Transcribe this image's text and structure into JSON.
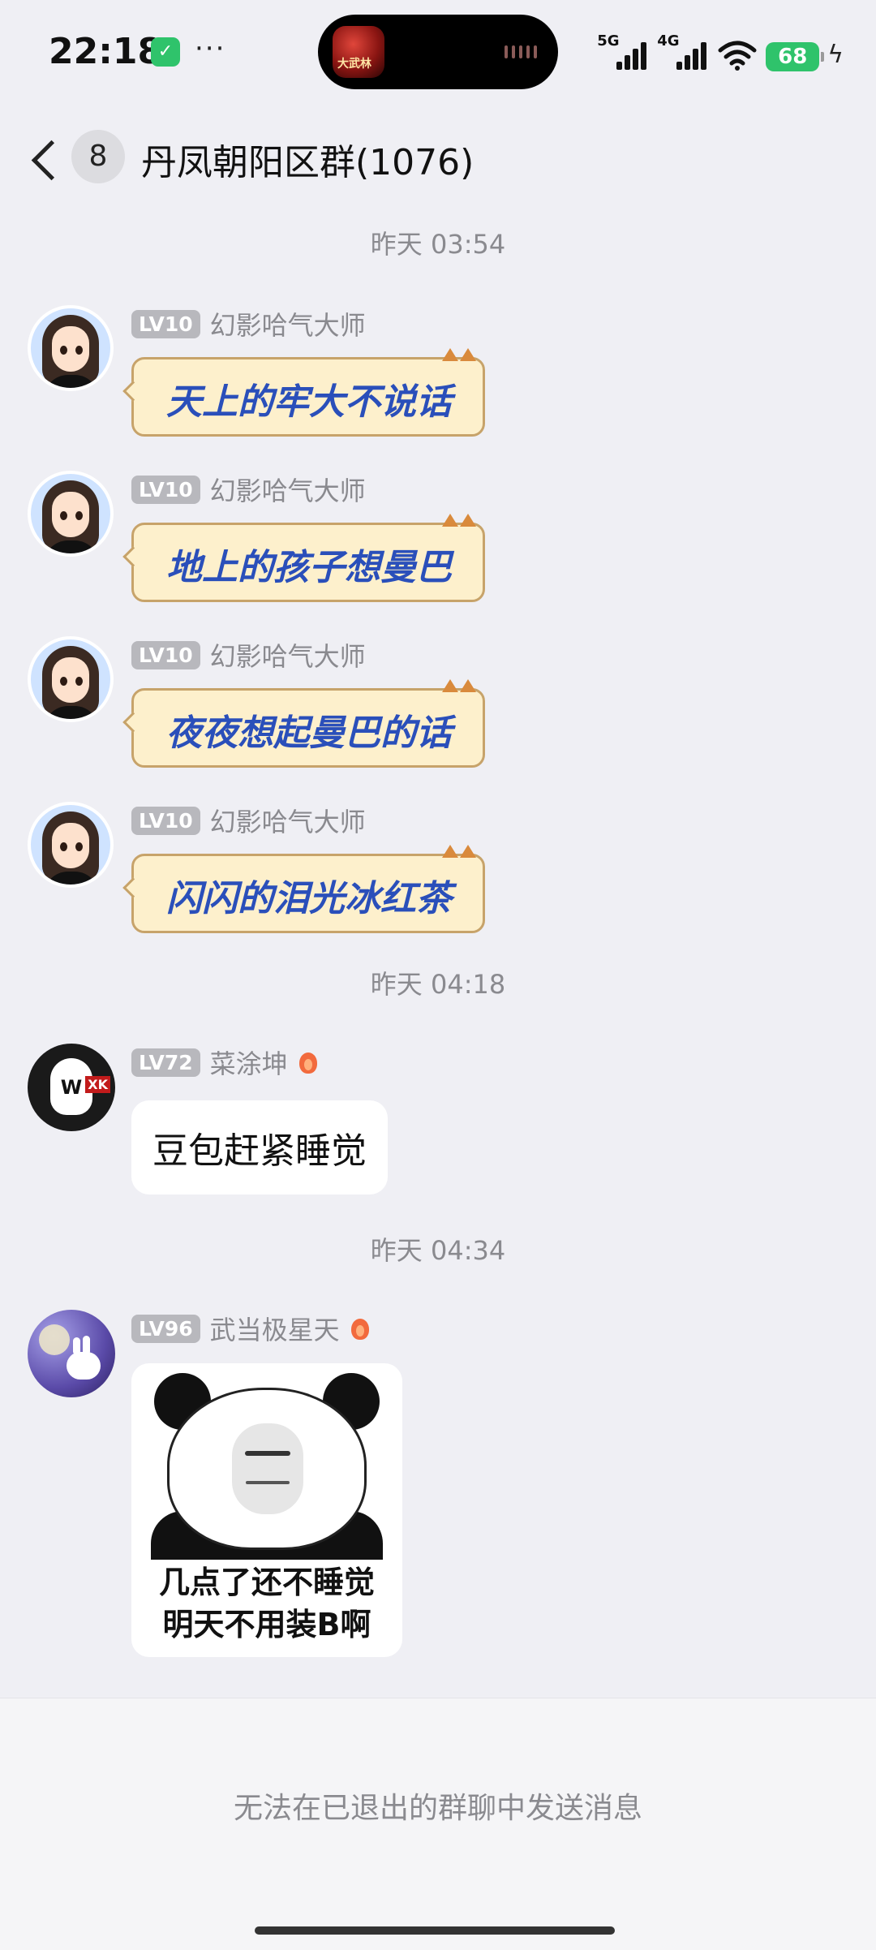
{
  "status_bar": {
    "time": "22:18",
    "shield_icon": "shield-check-icon",
    "dots": "···",
    "island_game_label": "大武林",
    "network_5g": "5G",
    "network_4g": "4G",
    "battery": "68",
    "charging_icon": "bolt-icon",
    "shield_color": "#2fc36b",
    "battery_color": "#2fc36b"
  },
  "header": {
    "unread_count": "8",
    "title": "丹凤朝阳区群(1076)",
    "back_icon": "chevron-left-icon"
  },
  "chat": {
    "time_separators": [
      "昨天 03:54",
      "昨天 04:18",
      "昨天 04:34"
    ],
    "messages": [
      {
        "level": "LV10",
        "nickname": "幻影哈气大师",
        "text": "天上的牢大不说话",
        "style": "cat-bubble"
      },
      {
        "level": "LV10",
        "nickname": "幻影哈气大师",
        "text": "地上的孩子想曼巴",
        "style": "cat-bubble"
      },
      {
        "level": "LV10",
        "nickname": "幻影哈气大师",
        "text": "夜夜想起曼巴的话",
        "style": "cat-bubble"
      },
      {
        "level": "LV10",
        "nickname": "幻影哈气大师",
        "text": "闪闪的泪光冰红茶",
        "style": "cat-bubble"
      },
      {
        "level": "LV72",
        "nickname": "菜涂坤",
        "text": "豆包赶紧睡觉",
        "style": "text",
        "badge_icon": "flame-icon"
      },
      {
        "level": "LV96",
        "nickname": "武当极星天",
        "style": "image",
        "badge_icon": "flame-icon",
        "image_caption_line1": "几点了还不睡觉",
        "image_caption_line2": "明天不用装B啊"
      }
    ],
    "bubble_text_color": "#2a4fba"
  },
  "footer": {
    "notice": "无法在已退出的群聊中发送消息"
  }
}
